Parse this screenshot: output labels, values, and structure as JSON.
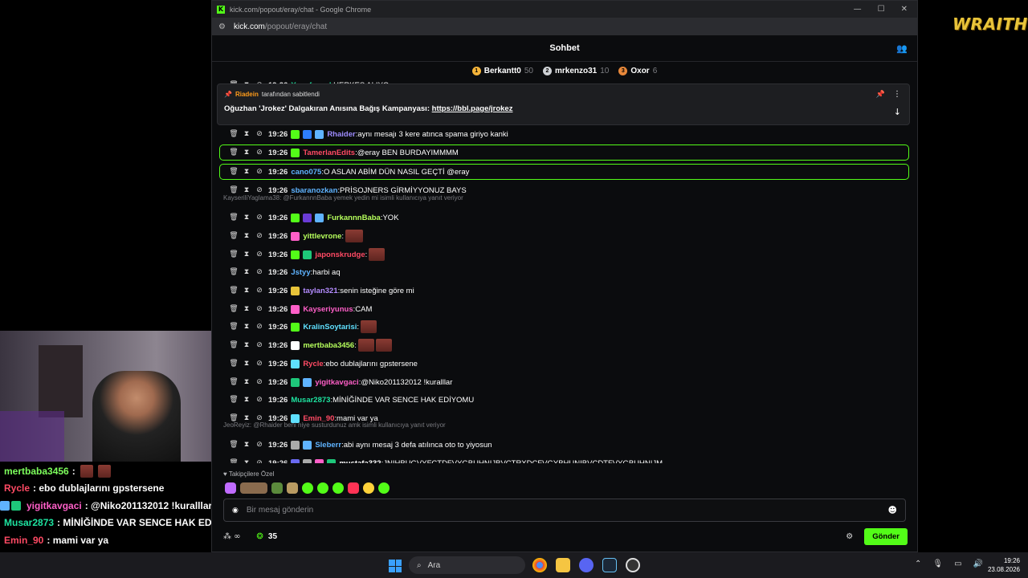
{
  "window": {
    "title": "kick.com/popout/eray/chat - Google Chrome",
    "url_host": "kick.com",
    "url_path": "/popout/eray/chat"
  },
  "chat": {
    "header": "Sohbet",
    "leaderboard": [
      {
        "rank": "1",
        "name": "Berkantt0",
        "count": "50"
      },
      {
        "rank": "2",
        "name": "mrkenzo31",
        "count": "10"
      },
      {
        "rank": "3",
        "name": "Oxor",
        "count": "6"
      }
    ],
    "pinned": {
      "by": "Riadein",
      "by_suffix": "tarafından sabitlendi",
      "text": "Oğuzhan 'Jrokez' Dalgakıran Anısına Bağış Kampanyası:",
      "link": "https://bbl.page/jrokez"
    },
    "partial_top": {
      "time": "19:26",
      "user": "Yusufcanal",
      "text": "HERKES ALIYO"
    },
    "messages": [
      {
        "time": "19:26",
        "user": "Rhaider",
        "color": "#9e8cff",
        "text": "aynı mesajı 3 kere atınca spama giriyo kanki",
        "badges": [
          "#53fc18",
          "#2e7dff",
          "#5fb3ff"
        ]
      },
      {
        "time": "19:26",
        "user": "TamerlanEdits",
        "color": "#ff4a64",
        "text": "@eray BEN BURDAYIMMMM",
        "badges": [
          "#53fc18"
        ],
        "hl": true
      },
      {
        "time": "19:26",
        "user": "cano075",
        "color": "#5fb3ff",
        "text": "O ASLAN ABİM DÜN NASIL GEÇTİ @eray",
        "badges": [],
        "hl": true
      },
      {
        "time": "19:26",
        "user": "sbaranozkan",
        "color": "#5fb3ff",
        "text": "PRİSOJNERS GİRMİYYONUZ BAYS",
        "badges": []
      },
      {
        "time": "19:26",
        "user": "FurkannnBaba",
        "color": "#b6ff5c",
        "text": "YOK",
        "badges": [
          "#53fc18",
          "#6a3bd6",
          "#5fb3ff"
        ]
      },
      {
        "time": "19:26",
        "user": "yittlevrone",
        "color": "#b6ff5c",
        "text": "",
        "badges": [
          "#ff5fc8"
        ],
        "emotes": 1
      },
      {
        "time": "19:26",
        "user": "japonskrudge",
        "color": "#ff4a64",
        "text": "",
        "badges": [
          "#53fc18",
          "#1ec77a"
        ],
        "emotes": 1
      },
      {
        "time": "19:26",
        "user": "Jstyy",
        "color": "#5fb3ff",
        "text": "harbi aq",
        "badges": []
      },
      {
        "time": "19:26",
        "user": "taylan321",
        "color": "#b48cff",
        "text": "senin isteğine göre mi",
        "badges": [
          "#e8c43a"
        ]
      },
      {
        "time": "19:26",
        "user": "Kayseriyunus",
        "color": "#ff5fc8",
        "text": "CAM",
        "badges": [
          "#ff5fc8"
        ]
      },
      {
        "time": "19:26",
        "user": "KralinSoytarisi",
        "color": "#5fe0ff",
        "text": "",
        "badges": [
          "#53fc18"
        ],
        "emotes": 1
      },
      {
        "time": "19:26",
        "user": "mertbaba3456",
        "color": "#b6ff5c",
        "text": "",
        "badges": [
          "#ffffff"
        ],
        "emotes": 2
      },
      {
        "time": "19:26",
        "user": "Rycle",
        "color": "#ff4a64",
        "text": "ebo dublajlarını gpstersene",
        "badges": [
          "#5fe0ff"
        ]
      },
      {
        "time": "19:26",
        "user": "yigitkavgaci",
        "color": "#ff5fc8",
        "text": "@Niko201132012 !kuralllar",
        "badges": [
          "#1ec77a",
          "#5fb3ff"
        ]
      },
      {
        "time": "19:26",
        "user": "Musar2873",
        "color": "#1ee3a0",
        "text": "MİNİĞİNDE VAR SENCE HAK EDİYOMU",
        "badges": []
      },
      {
        "time": "19:26",
        "user": "Emin_90",
        "color": "#ff4a64",
        "text": "mami var ya",
        "badges": [
          "#5fe0ff"
        ]
      },
      {
        "time": "19:26",
        "user": "Sleberr",
        "color": "#5fb3ff",
        "text": "abi aynı mesaj 3 defa atılınca oto to yiyosun",
        "badges": [
          "#aaaaaa",
          "#5fb3ff"
        ]
      },
      {
        "time": "19:26",
        "user": "mustafa332",
        "color": "#ffffff",
        "text": "JNIHBUGVYFCTDFVYGBUHNIJBVCTRXDCFVGYBHUNIBVCDTFVYGBUHNIJM",
        "badges": [
          "#6a6af0",
          "#aaaaaa",
          "#ff5fc8",
          "#1ec77a"
        ]
      }
    ],
    "replies": [
      "KayseriliYaglama38: @FurkannnBaba yemek yedin mi isimli kullanıcıya yanıt veriyor",
      "JeoReyiz: @Rhaider beni niye susturdunuz amk isimli kullanıcıya yanıt veriyor"
    ],
    "followers_label": "Takipçilere Özel",
    "input_placeholder": "Bir mesaj gönderin",
    "points": "35",
    "send_label": "Gönder"
  },
  "stream_chat": [
    {
      "user": "mertbaba3456",
      "user_color": "#7dff5c",
      "text": ":"
    },
    {
      "user": "Rycle",
      "user_color": "#ff4a64",
      "text": ": ebo dublajlarını gpstersene"
    },
    {
      "user": "yigitkavgaci",
      "user_color": "#ff5fc8",
      "text": ": @Niko201132012 !kuralllar"
    },
    {
      "user": "Musar2873",
      "user_color": "#1ee3a0",
      "text": ": MİNİĞİNDE VAR SENCE HAK EDİYOM"
    },
    {
      "user": "Emin_90",
      "user_color": "#ff4a64",
      "text": ": mami var ya"
    },
    {
      "user": "Sleberr",
      "user_color": "#5fb3ff",
      "text": ": abi aynı mesaj 3 defa atılınca oto to y"
    },
    {
      "user": "mustafa332",
      "user_color": "#ffffff",
      "text": ":"
    }
  ],
  "overlay_logo": "WRAITH",
  "taskbar": {
    "search_label": "Ara",
    "time": "19:26",
    "date": "23.08.2026"
  }
}
